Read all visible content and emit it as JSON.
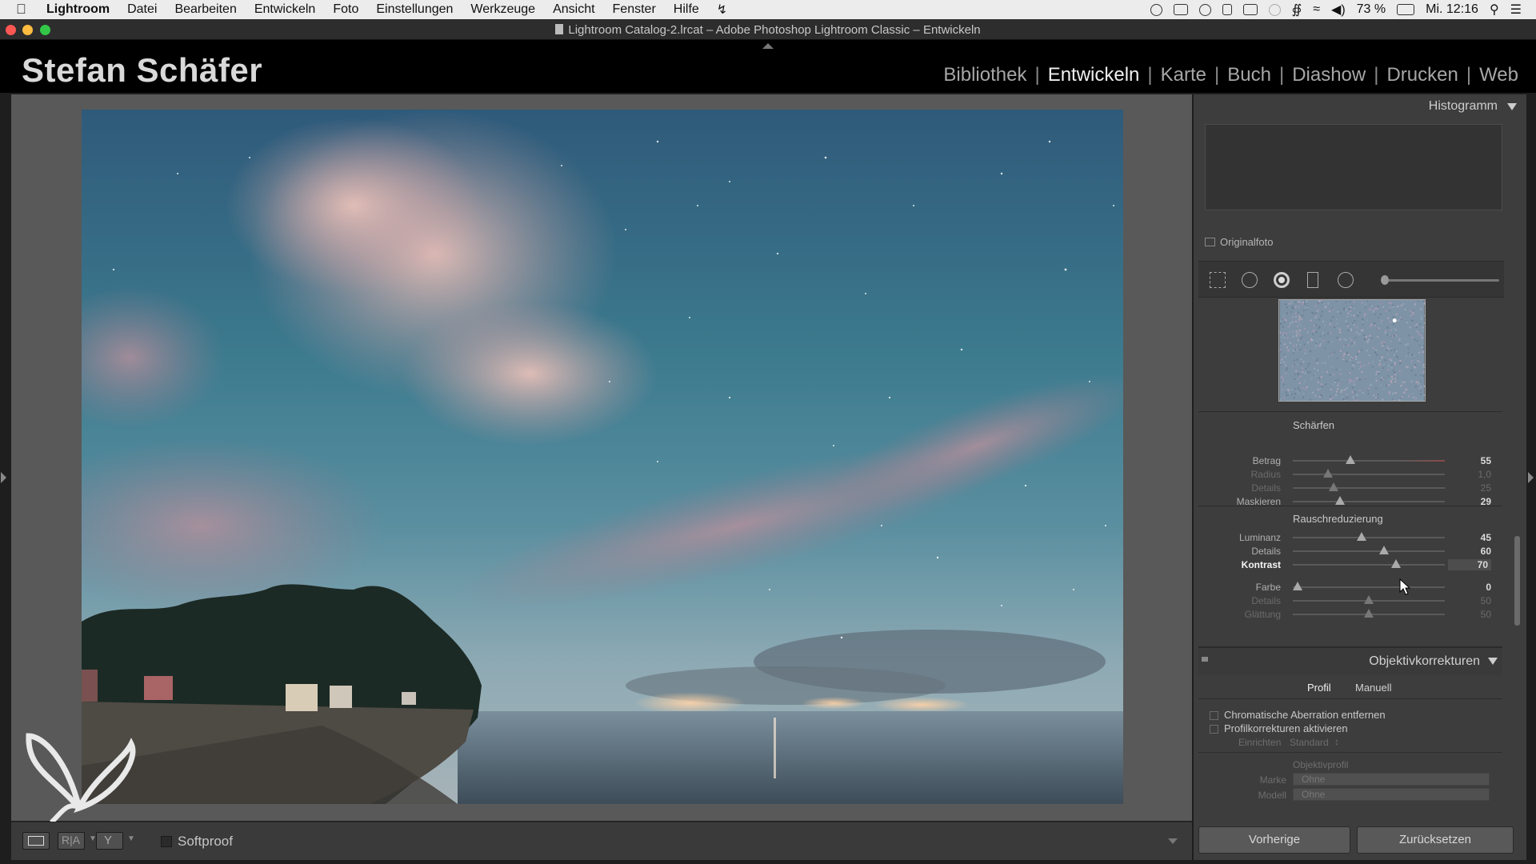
{
  "menubar": {
    "app": "Lightroom",
    "items": [
      "Datei",
      "Bearbeiten",
      "Entwickeln",
      "Foto",
      "Einstellungen",
      "Werkzeuge",
      "Ansicht",
      "Fenster",
      "Hilfe"
    ],
    "battery": "73 %",
    "clock": "Mi. 12:16"
  },
  "window": {
    "title": "Lightroom Catalog-2.lrcat – Adobe Photoshop Lightroom Classic – Entwickeln"
  },
  "identity_plate": "Stefan Schäfer",
  "modules": {
    "items": [
      "Bibliothek",
      "Entwickeln",
      "Karte",
      "Buch",
      "Diashow",
      "Drucken",
      "Web"
    ],
    "active": "Entwickeln",
    "separator": "|"
  },
  "toolbar": {
    "softproof_label": "Softproof",
    "softproof_checked": false
  },
  "histogram": {
    "title": "Histogramm",
    "original_label": "Originalfoto"
  },
  "detail": {
    "sharpen": {
      "title": "Schärfen",
      "sliders": [
        {
          "label": "Betrag",
          "value": "55",
          "pos": 0.38,
          "dim": false
        },
        {
          "label": "Radius",
          "value": "1,0",
          "pos": 0.23,
          "dim": true
        },
        {
          "label": "Details",
          "value": "25",
          "pos": 0.27,
          "dim": true
        },
        {
          "label": "Maskieren",
          "value": "29",
          "pos": 0.31,
          "dim": false
        }
      ]
    },
    "noise": {
      "title": "Rauschreduzierung",
      "sliders": [
        {
          "label": "Luminanz",
          "value": "45",
          "pos": 0.45,
          "dim": false
        },
        {
          "label": "Details",
          "value": "60",
          "pos": 0.6,
          "dim": false
        },
        {
          "label": "Kontrast",
          "value": "70",
          "pos": 0.68,
          "dim": false,
          "active": true
        },
        {
          "label": "Farbe",
          "value": "0",
          "pos": 0.03,
          "dim": false
        },
        {
          "label": "Details",
          "value": "50",
          "pos": 0.5,
          "dim": true
        },
        {
          "label": "Glättung",
          "value": "50",
          "pos": 0.5,
          "dim": true
        }
      ]
    }
  },
  "lens": {
    "title": "Objektivkorrekturen",
    "tabs": [
      "Profil",
      "Manuell"
    ],
    "checkboxes": [
      "Chromatische Aberration entfernen",
      "Profilkorrekturen aktivieren"
    ],
    "einrichten_label": "Einrichten",
    "einrichten_value": "Standard",
    "profil_heading": "Objektivprofil",
    "marke_label": "Marke",
    "marke_value": "Ohne",
    "modell_label": "Modell",
    "modell_value": "Ohne"
  },
  "buttons": {
    "previous": "Vorherige",
    "reset": "Zurücksetzen"
  },
  "colors": {
    "panel_bg": "#3d3d3d",
    "workspace_bg": "#595959",
    "text_active": "#f0f0f0",
    "text_inactive": "#a6a6a6"
  }
}
